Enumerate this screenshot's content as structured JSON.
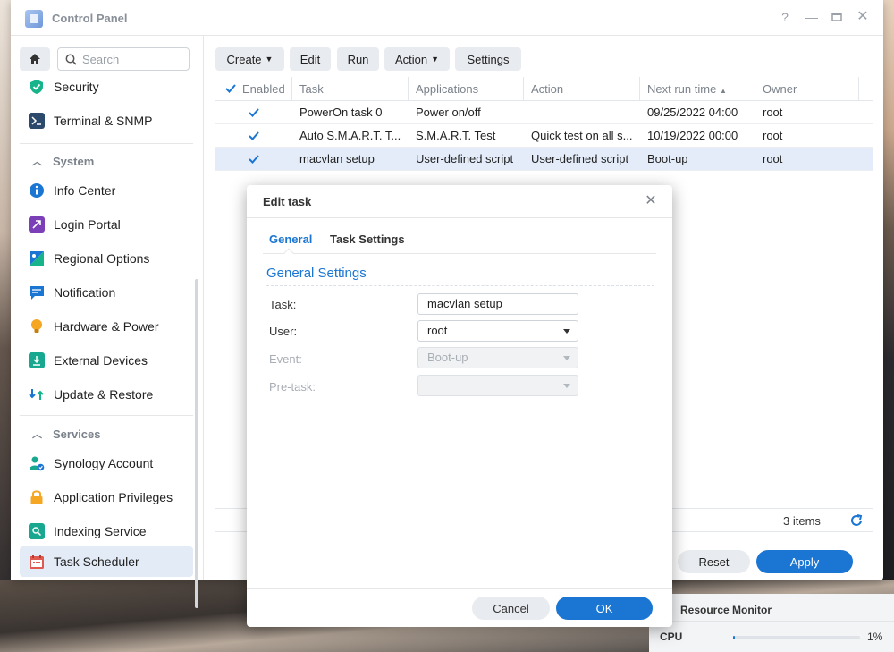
{
  "window": {
    "title": "Control Panel"
  },
  "sidebar": {
    "search_placeholder": "Search",
    "items_top": [
      {
        "label": "Security"
      },
      {
        "label": "Terminal & SNMP"
      }
    ],
    "section_system": "System",
    "items_system": [
      {
        "label": "Info Center"
      },
      {
        "label": "Login Portal"
      },
      {
        "label": "Regional Options"
      },
      {
        "label": "Notification"
      },
      {
        "label": "Hardware & Power"
      },
      {
        "label": "External Devices"
      },
      {
        "label": "Update & Restore"
      }
    ],
    "section_services": "Services",
    "items_services": [
      {
        "label": "Synology Account"
      },
      {
        "label": "Application Privileges"
      },
      {
        "label": "Indexing Service"
      },
      {
        "label": "Task Scheduler"
      }
    ]
  },
  "toolbar": {
    "create": "Create",
    "edit": "Edit",
    "run": "Run",
    "action": "Action",
    "settings": "Settings"
  },
  "grid": {
    "columns": [
      "Enabled",
      "Task",
      "Applications",
      "Action",
      "Next run time",
      "Owner"
    ],
    "rows": [
      {
        "task": "PowerOn task 0",
        "app": "Power on/off",
        "action": "",
        "next": "09/25/2022 04:00",
        "owner": "root"
      },
      {
        "task": "Auto S.M.A.R.T. T...",
        "app": "S.M.A.R.T. Test",
        "action": "Quick test on all s...",
        "next": "10/19/2022 00:00",
        "owner": "root"
      },
      {
        "task": "macvlan setup",
        "app": "User-defined script",
        "action": "User-defined script",
        "next": "Boot-up",
        "owner": "root"
      }
    ],
    "items_count": "3 items"
  },
  "main_buttons": {
    "reset": "Reset",
    "apply": "Apply"
  },
  "dialog": {
    "title": "Edit task",
    "tabs": [
      "General",
      "Task Settings"
    ],
    "section": "General Settings",
    "fields": {
      "task_label": "Task:",
      "task_value": "macvlan setup",
      "user_label": "User:",
      "user_value": "root",
      "event_label": "Event:",
      "event_value": "Boot-up",
      "pretask_label": "Pre-task:",
      "pretask_value": ""
    },
    "cancel": "Cancel",
    "ok": "OK"
  },
  "resource_monitor": {
    "title": "Resource Monitor",
    "cpu_label": "CPU",
    "cpu_value": "1%",
    "cpu_fraction": 0.01
  },
  "colors": {
    "accent": "#1a76d2",
    "selected_row": "#e3ecf8"
  }
}
